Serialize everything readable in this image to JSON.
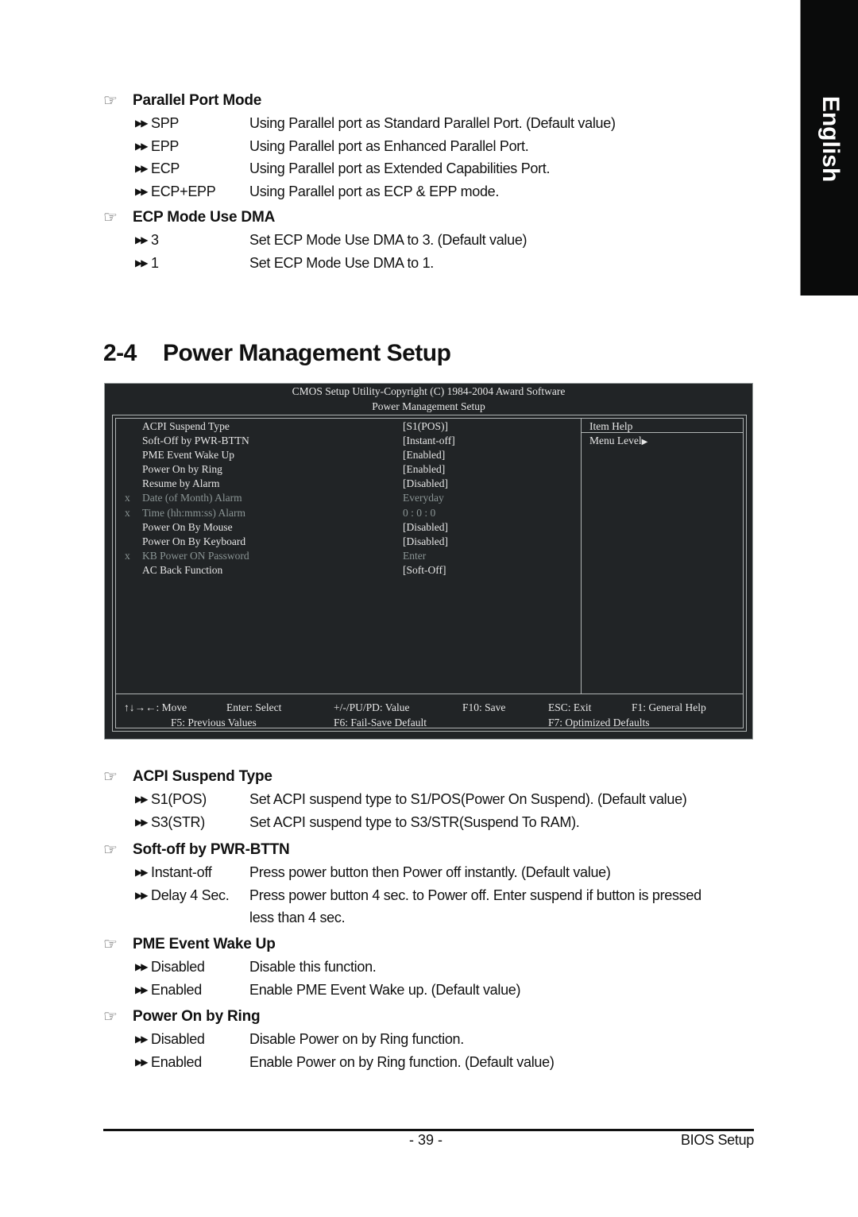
{
  "side_tab": {
    "label": "English"
  },
  "icons": {
    "section_bullet": "pointing-hand-icon",
    "option_bullet": "double-arrow-icon",
    "hand_glyph": "☞",
    "arrow_glyph": "▶▶"
  },
  "sections_top": [
    {
      "title": "Parallel Port Mode",
      "options": [
        {
          "name": "SPP",
          "desc": "Using Parallel port as Standard Parallel Port. (Default value)"
        },
        {
          "name": "EPP",
          "desc": "Using Parallel port as Enhanced Parallel Port."
        },
        {
          "name": "ECP",
          "desc": "Using Parallel port as Extended Capabilities Port."
        },
        {
          "name": "ECP+EPP",
          "desc": "Using Parallel port as ECP & EPP mode."
        }
      ]
    },
    {
      "title": "ECP Mode Use DMA",
      "options": [
        {
          "name": "3",
          "desc": "Set ECP Mode Use DMA to 3. (Default value)"
        },
        {
          "name": "1",
          "desc": "Set ECP Mode Use DMA to 1."
        }
      ]
    }
  ],
  "chapter": {
    "number": "2-4",
    "title": "Power Management Setup"
  },
  "bios": {
    "header_line1": "CMOS Setup Utility-Copyright (C) 1984-2004 Award Software",
    "header_line2": "Power Management Setup",
    "rows": [
      {
        "marker": "",
        "label": "ACPI Suspend Type",
        "value": "[S1(POS)]",
        "disabled": false
      },
      {
        "marker": "",
        "label": "Soft-Off by PWR-BTTN",
        "value": "[Instant-off]",
        "disabled": false
      },
      {
        "marker": "",
        "label": "PME Event Wake Up",
        "value": "[Enabled]",
        "disabled": false
      },
      {
        "marker": "",
        "label": "Power On by Ring",
        "value": "[Enabled]",
        "disabled": false
      },
      {
        "marker": "",
        "label": "Resume by Alarm",
        "value": "[Disabled]",
        "disabled": false
      },
      {
        "marker": "x",
        "label": "Date (of Month) Alarm",
        "value": "Everyday",
        "disabled": true
      },
      {
        "marker": "x",
        "label": "Time (hh:mm:ss) Alarm",
        "value": "0 : 0 : 0",
        "disabled": true
      },
      {
        "marker": "",
        "label": "Power On By Mouse",
        "value": "[Disabled]",
        "disabled": false
      },
      {
        "marker": "",
        "label": "Power On By Keyboard",
        "value": "[Disabled]",
        "disabled": false
      },
      {
        "marker": "x",
        "label": "KB Power ON Password",
        "value": "Enter",
        "disabled": true
      },
      {
        "marker": "",
        "label": "AC Back Function",
        "value": "[Soft-Off]",
        "disabled": false
      }
    ],
    "help_title": "Item Help",
    "menu_level": "Menu Level",
    "menu_level_icon": "▶",
    "footer": {
      "move": "↑↓→←: Move",
      "select": "Enter: Select",
      "value": "+/-/PU/PD: Value",
      "save": "F10: Save",
      "exit": "ESC: Exit",
      "help": "F1: General Help",
      "prev": "F5: Previous Values",
      "failsafe": "F6: Fail-Save Default",
      "optimized": "F7: Optimized Defaults"
    }
  },
  "sections_bottom": [
    {
      "title": "ACPI Suspend Type",
      "options": [
        {
          "name": "S1(POS)",
          "desc": "Set ACPI suspend type to S1/POS(Power On Suspend). (Default value)"
        },
        {
          "name": "S3(STR)",
          "desc": "Set ACPI suspend type to S3/STR(Suspend To RAM)."
        }
      ]
    },
    {
      "title": "Soft-off by PWR-BTTN",
      "options": [
        {
          "name": "Instant-off",
          "desc": "Press power button then Power off instantly. (Default value)"
        },
        {
          "name": "Delay 4 Sec.",
          "desc": "Press power button 4 sec. to Power off. Enter suspend if button is pressed",
          "desc2": "less than 4 sec."
        }
      ]
    },
    {
      "title": "PME Event Wake Up",
      "options": [
        {
          "name": "Disabled",
          "desc": "Disable this function."
        },
        {
          "name": "Enabled",
          "desc": "Enable PME Event Wake up. (Default value)"
        }
      ]
    },
    {
      "title": "Power On by Ring",
      "options": [
        {
          "name": "Disabled",
          "desc": "Disable Power on by Ring function."
        },
        {
          "name": "Enabled",
          "desc": "Enable Power on by Ring function. (Default value)"
        }
      ]
    }
  ],
  "footer": {
    "page_number": "- 39 -",
    "right_label": "BIOS Setup"
  }
}
